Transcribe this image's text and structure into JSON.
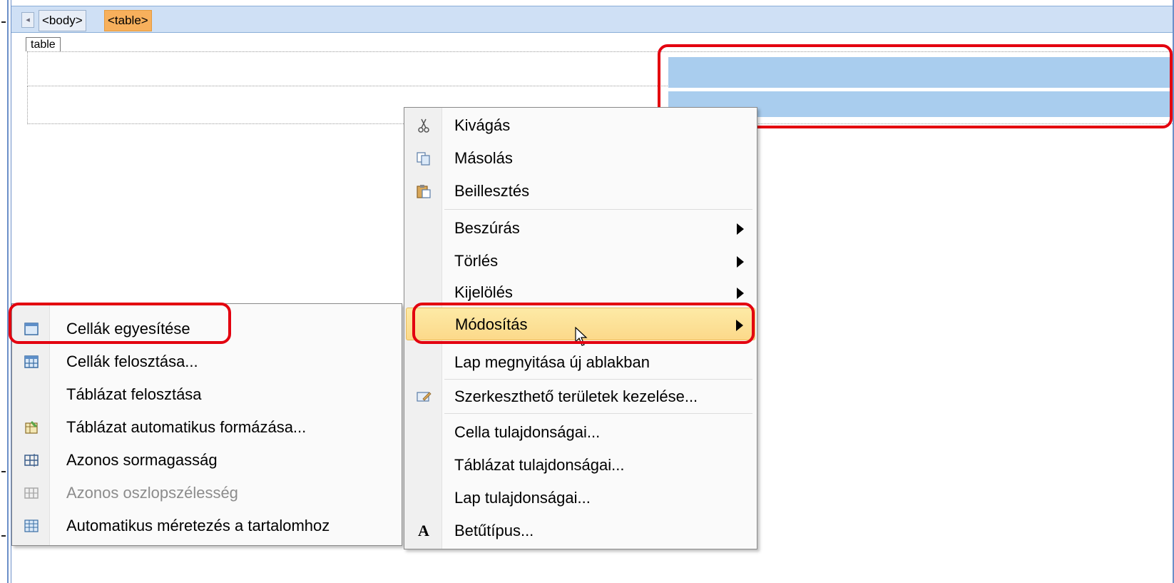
{
  "tagbar": {
    "scroll_left": "◂",
    "tags": [
      "<body>",
      "<table>"
    ]
  },
  "design": {
    "table_label": "table"
  },
  "context_menu": {
    "items": [
      {
        "label": "Kivágás",
        "icon": "scissors-icon"
      },
      {
        "label": "Másolás",
        "icon": "copy-icon"
      },
      {
        "label": "Beillesztés",
        "icon": "paste-icon"
      },
      {
        "label": "Beszúrás",
        "submenu": true
      },
      {
        "label": "Törlés",
        "submenu": true
      },
      {
        "label": "Kijelölés",
        "submenu": true
      },
      {
        "label": "Módosítás",
        "submenu": true,
        "highlighted": true
      },
      {
        "label": "Lap megnyitása új ablakban"
      },
      {
        "label": "Szerkeszthető területek kezelése...",
        "icon": "editable-regions-icon"
      },
      {
        "label": "Cella tulajdonságai..."
      },
      {
        "label": "Táblázat tulajdonságai..."
      },
      {
        "label": "Lap tulajdonságai..."
      },
      {
        "label": "Betűtípus...",
        "icon": "font-icon"
      }
    ],
    "font_icon_glyph": "A"
  },
  "modify_submenu": {
    "items": [
      {
        "label": "Cellák egyesítése",
        "icon": "merge-cells-icon"
      },
      {
        "label": "Cellák felosztása...",
        "icon": "split-cells-icon"
      },
      {
        "label": "Táblázat felosztása"
      },
      {
        "label": "Táblázat automatikus formázása...",
        "icon": "autoformat-icon"
      },
      {
        "label": "Azonos sormagasság",
        "icon": "distribute-rows-icon"
      },
      {
        "label": "Azonos oszlopszélesség",
        "icon": "distribute-columns-icon",
        "disabled": true
      },
      {
        "label": "Automatikus méretezés a tartalomhoz",
        "icon": "autofit-icon"
      }
    ]
  },
  "colors": {
    "highlight": "#fcd98a",
    "selection": "#a9cdee",
    "annotation": "#e3000f",
    "tag_active": "#f7b05c"
  }
}
